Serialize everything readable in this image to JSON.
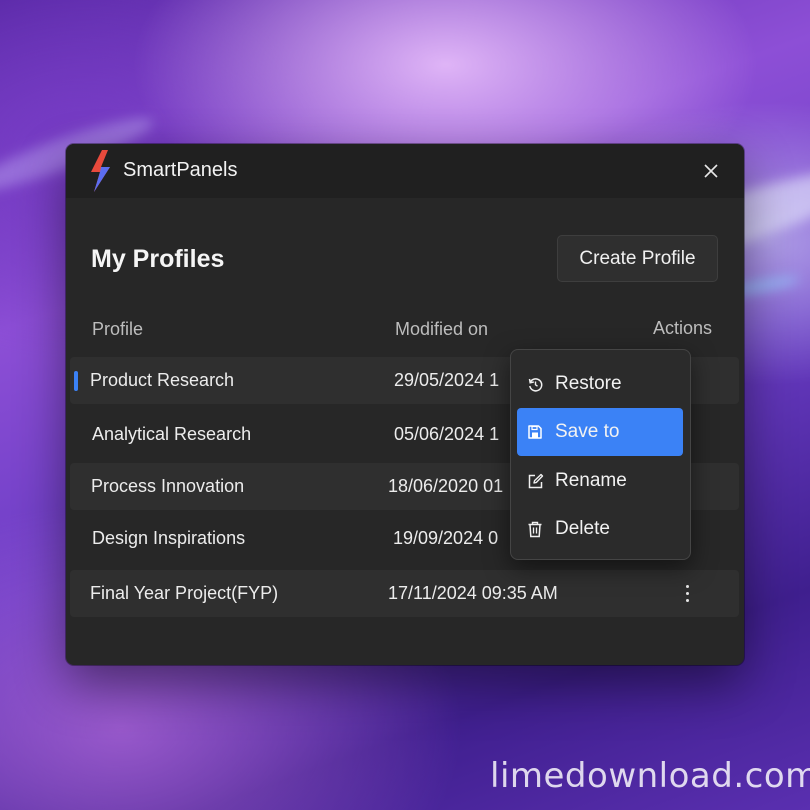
{
  "window": {
    "app_title": "SmartPanels",
    "page_title": "My Profiles",
    "create_button_label": "Create Profile"
  },
  "columns": {
    "profile": "Profile",
    "modified": "Modified on",
    "actions": "Actions"
  },
  "rows": [
    {
      "name": "Product Research",
      "modified": "29/05/2024 1",
      "selected": true
    },
    {
      "name": "Analytical Research",
      "modified": "05/06/2024 1"
    },
    {
      "name": "Process Innovation",
      "modified": "18/06/2020 01"
    },
    {
      "name": "Design Inspirations",
      "modified": "19/09/2024 0"
    },
    {
      "name": "Final Year Project(FYP)",
      "modified": "17/11/2024 09:35 AM"
    }
  ],
  "context_menu": {
    "items": [
      {
        "label": "Restore",
        "icon": "restore-icon"
      },
      {
        "label": "Save to",
        "icon": "save-icon",
        "active": true
      },
      {
        "label": "Rename",
        "icon": "rename-icon"
      },
      {
        "label": "Delete",
        "icon": "trash-icon"
      }
    ]
  },
  "watermark": "limedownload.com",
  "colors": {
    "accent": "#3b82f6",
    "window_bg": "#272727",
    "titlebar_bg": "#202020"
  }
}
